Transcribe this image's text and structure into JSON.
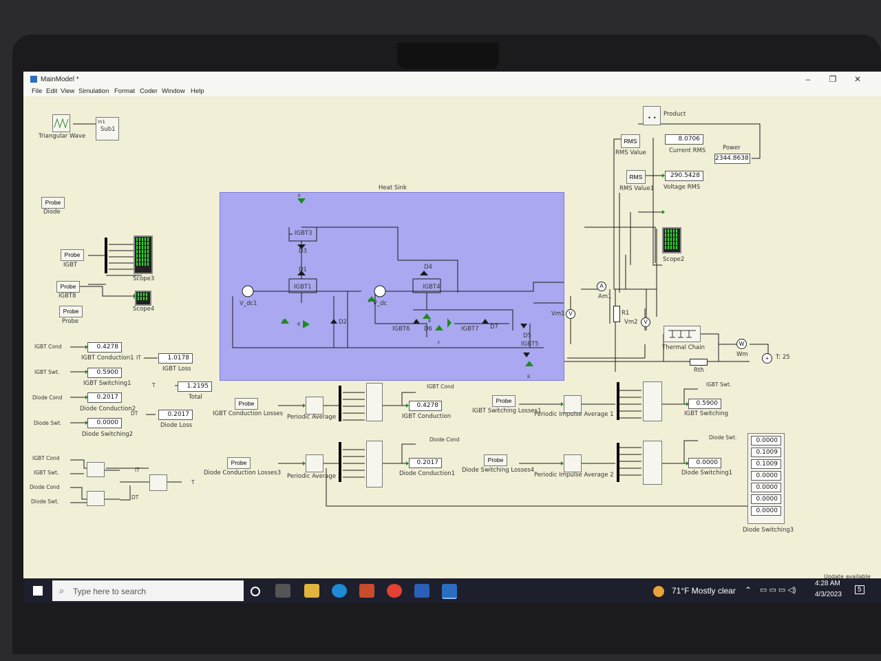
{
  "window": {
    "title": "MainModel *"
  },
  "menu": [
    "File",
    "Edit",
    "View",
    "Simulation",
    "Format",
    "Coder",
    "Window",
    "Help"
  ],
  "top_blocks": {
    "triangular_wave": "Triangular Wave",
    "in1": "In1",
    "sub1": "Sub1"
  },
  "heatsink": {
    "label": "Heat Sink"
  },
  "circuit_labels": {
    "igbt3": "IGBT3",
    "d3": "D3",
    "d1": "D1",
    "igbt1": "IGBT1",
    "d2": "D2",
    "d4": "D4",
    "igbt4": "IGBT4",
    "igbt6": "IGBT6",
    "d6": "D6",
    "igbt7": "IGBT7",
    "d7": "D7",
    "d5": "D5",
    "igbt5": "IGBT5",
    "vdc1": "V_dc1",
    "vdc": "V_dc",
    "k": "K",
    "j": "J",
    "b": "B",
    "f": "F",
    "i1": "I",
    "i2": "I",
    "am1": "Am1",
    "vm1": "Vm1",
    "vm2": "Vm2",
    "r1": "R1",
    "rth": "Rth",
    "wm": "Wm",
    "t25": "T: 25",
    "thermal": "Thermal Chain"
  },
  "measure": {
    "product": "Product",
    "rms": "RMS",
    "rms_value": "RMS Value",
    "rms_value1": "RMS Value1",
    "current_rms_val": "8.0706",
    "current_rms": "Current RMS",
    "voltage_rms_val": "290.5428",
    "voltage_rms": "Voltage RMS",
    "power": "Power",
    "power_val": "2344.8638",
    "scope2": "Scope2"
  },
  "left": {
    "probe": "Probe",
    "diode": "Diode",
    "igbt": "IGBT",
    "igbt8": "IGBT8",
    "probe_lbl": "Probe",
    "scope3": "Scope3",
    "scope4": "Scope4",
    "igbt_cond": "IGBT Cond",
    "igbt_swt": "IGBT Swt.",
    "diode_cond": "Diode Cond",
    "diode_swt": "Diode Swt.",
    "v1": "0.4278",
    "l1": "IGBT Conduction1",
    "v2": "0.5900",
    "l2": "IGBT Switching1",
    "v3": "0.2017",
    "l3": "Diode Conduction2",
    "v4": "0.0000",
    "l4": "Diode Switching2",
    "it": "IT",
    "it_val": "1.0178",
    "igbt_loss": "IGBT Loss",
    "t": "T",
    "total_val": "1.2195",
    "total": "Total",
    "dt": "DT",
    "diode_loss_val": "0.2017",
    "diode_loss": "Diode Loss"
  },
  "bottom_left": {
    "igbt_cond": "IGBT Cond",
    "igbt_swt": "IGBT Swt.",
    "diode_cond": "Diode Cond",
    "diode_swt": "Diode Swt.",
    "it": "IT",
    "dt": "DT",
    "t": "T"
  },
  "losses": {
    "probe": "Probe",
    "igbt_cond_losses": "IGBT Conduction Losses",
    "periodic_avg1": "Periodic Average 1",
    "igbt_cond_tag": "IGBT Cond",
    "igbt_cond_val": "0.4278",
    "igbt_cond": "IGBT Conduction",
    "igbt_sw_losses": "IGBT Switching Losses1",
    "pia1": "Periodic Impulse Average 1",
    "igbt_swt_tag": "IGBT Swt.",
    "igbt_sw_val": "0.5900",
    "igbt_sw": "IGBT Switching",
    "diode_cond_losses": "Diode Conduction Losses3",
    "periodic_avg2": "Periodic Average 2",
    "diode_cond_tag": "Diode Cond",
    "diode_cond_val": "0.2017",
    "diode_cond": "Diode Conduction1",
    "diode_sw_losses": "Diode Switching Losses4",
    "pia2": "Periodic Impulse Average 2",
    "diode_swt_tag": "Diode Swt.",
    "diode_sw_val": "0.0000",
    "diode_sw": "Diode Switching1",
    "ds3_values": [
      "0.0000",
      "0.1009",
      "0.1009",
      "0.0000",
      "0.0000",
      "0.0000",
      "0.0000"
    ],
    "ds3": "Diode Switching3"
  },
  "status": {
    "update": "Update available"
  },
  "taskbar": {
    "search": "Type here to search",
    "weather": "71°F  Mostly clear",
    "time": "4:28 AM",
    "date": "4/3/2023",
    "notif": "5"
  }
}
